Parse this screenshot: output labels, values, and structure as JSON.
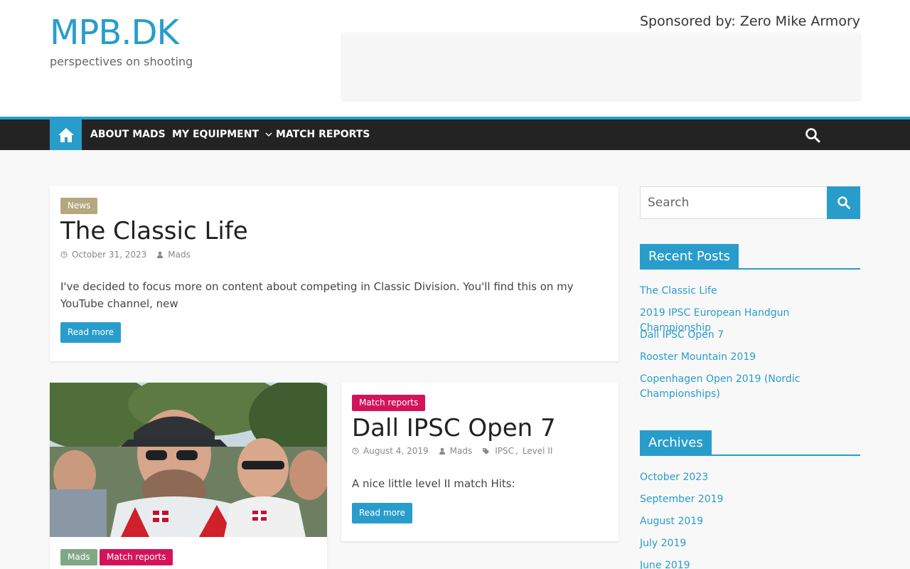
{
  "header": {
    "site_title": "MPB.DK",
    "tagline": "perspectives on shooting",
    "sponsor": "Sponsored by: Zero Mike Armory"
  },
  "nav": {
    "items": [
      "ABOUT MADS",
      "MY EQUIPMENT",
      "MATCH REPORTS"
    ]
  },
  "posts": [
    {
      "category": "News",
      "title": "The Classic Life",
      "date": "October 31, 2023",
      "author": "Mads",
      "excerpt": "I've decided to focus more on content about competing in Classic Division. You'll find this on my YouTube channel, new",
      "read_more": "Read more"
    },
    {
      "category": "Match reports",
      "title": "Dall IPSC Open 7",
      "date": "August 4, 2019",
      "author": "Mads",
      "tags": [
        "IPSC",
        "Level II"
      ],
      "excerpt": "A nice little level II match Hits:",
      "read_more": "Read more"
    },
    {
      "categories": [
        "Mads",
        "Match reports"
      ]
    }
  ],
  "sidebar": {
    "search_placeholder": "Search",
    "recent_title": "Recent Posts",
    "recent": [
      "The Classic Life",
      "2019 IPSC European Handgun Championship",
      "Dall IPSC Open 7",
      "Rooster Mountain 2019",
      "Copenhagen Open 2019 (Nordic Championships)"
    ],
    "archives_title": "Archives",
    "archives": [
      "October 2023",
      "September 2019",
      "August 2019",
      "July 2019",
      "June 2019"
    ]
  },
  "colors": {
    "accent": "#289dcc",
    "nav_bg": "#232323",
    "news_badge": "#b5a77e",
    "match_badge": "#d4145a",
    "mads_badge": "#7fa886"
  }
}
